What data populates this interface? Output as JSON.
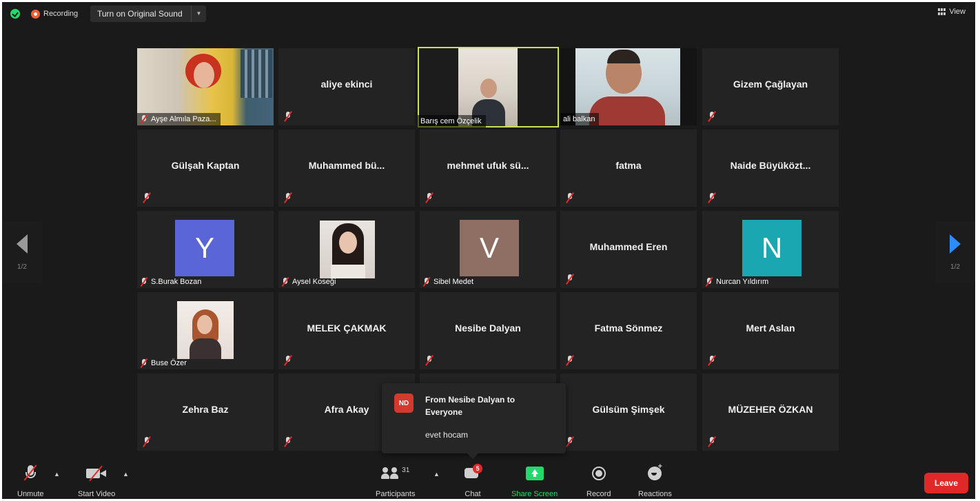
{
  "topbar": {
    "recording_label": "Recording",
    "original_sound_label": "Turn on Original Sound",
    "view_label": "View"
  },
  "pagination": {
    "left_page": "1/2",
    "right_page": "1/2"
  },
  "tiles": [
    {
      "name": "Ayşe Almıla Paza...",
      "kind": "video"
    },
    {
      "name": "aliye ekinci",
      "kind": "name"
    },
    {
      "name": "Barış cem Özçelik",
      "kind": "video",
      "active": true
    },
    {
      "name": "ali balkan",
      "kind": "video"
    },
    {
      "name": "Gizem Çağlayan",
      "kind": "name"
    },
    {
      "name": "Gülşah Kaptan",
      "kind": "name"
    },
    {
      "name": "Muhammed bü...",
      "kind": "name"
    },
    {
      "name": "mehmet ufuk sü...",
      "kind": "name"
    },
    {
      "name": "fatma",
      "kind": "name"
    },
    {
      "name": "Naide Büyüközt...",
      "kind": "name"
    },
    {
      "name": "S.Burak Bozan",
      "kind": "avatar",
      "avatar_letter": "Y",
      "avatar_color": "#5b66d6"
    },
    {
      "name": "Aysel Koseği",
      "kind": "photo"
    },
    {
      "name": "Sibel Medet",
      "kind": "avatar",
      "avatar_letter": "V",
      "avatar_color": "#8f6f63"
    },
    {
      "name": "Muhammed Eren",
      "kind": "name"
    },
    {
      "name": "Nurcan Yıldırım",
      "kind": "avatar",
      "avatar_letter": "N",
      "avatar_color": "#1aa7b2"
    },
    {
      "name": "Buse Özer",
      "kind": "photo"
    },
    {
      "name": "MELEK ÇAKMAK",
      "kind": "name"
    },
    {
      "name": "Nesibe Dalyan",
      "kind": "name"
    },
    {
      "name": "Fatma Sönmez",
      "kind": "name"
    },
    {
      "name": "Mert Aslan",
      "kind": "name"
    },
    {
      "name": "Zehra Baz",
      "kind": "name"
    },
    {
      "name": "Afra Akay",
      "kind": "name"
    },
    {
      "name": "",
      "kind": "hidden"
    },
    {
      "name": "Gülsüm Şimşek",
      "kind": "name"
    },
    {
      "name": "MÜZEHER ÖZKAN",
      "kind": "name"
    }
  ],
  "chat_popup": {
    "initials": "ND",
    "from": "From Nesibe Dalyan to Everyone",
    "message": "evet hocam"
  },
  "toolbar": {
    "unmute": "Unmute",
    "start_video": "Start Video",
    "participants": "Participants",
    "participants_count": "31",
    "chat": "Chat",
    "chat_badge": "5",
    "share_screen": "Share Screen",
    "record": "Record",
    "reactions": "Reactions",
    "leave": "Leave"
  },
  "colors": {
    "accent_green": "#23d96c",
    "active_speaker": "#c9e353",
    "leave_red": "#e02828",
    "nav_blue": "#2d8cff"
  }
}
